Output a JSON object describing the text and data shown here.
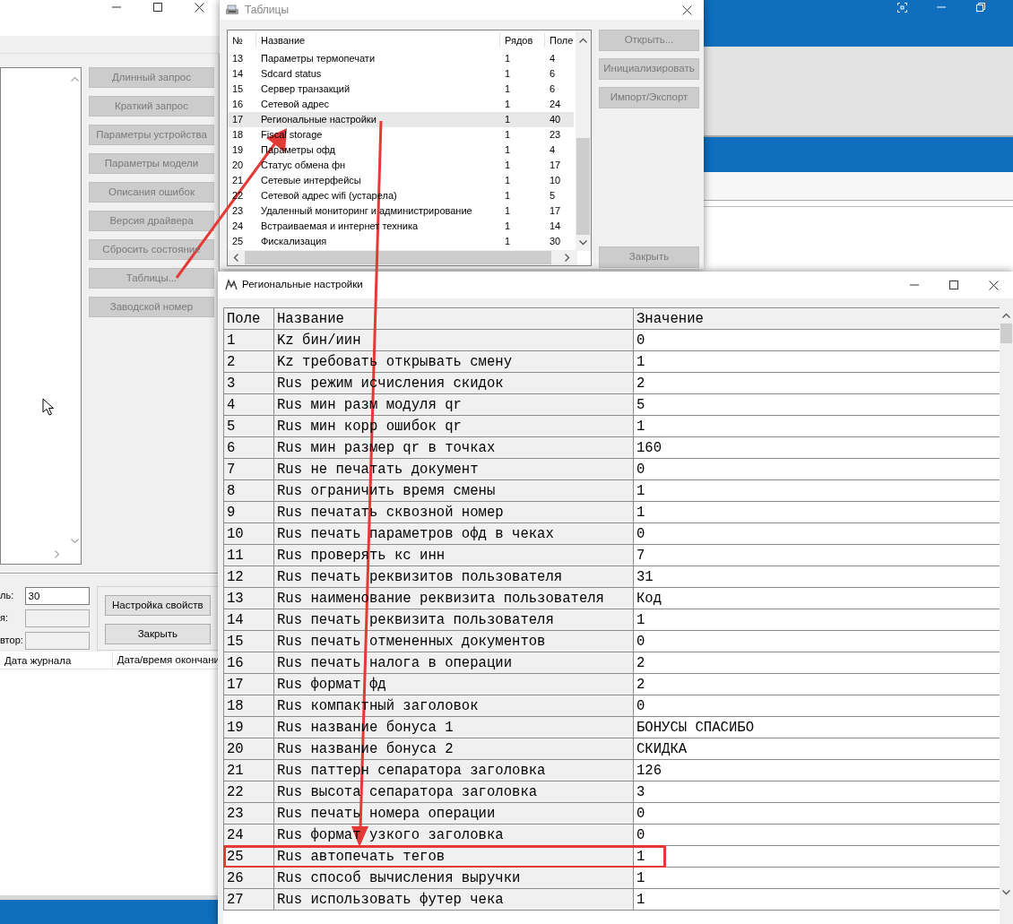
{
  "main_window": {
    "buttons": [
      {
        "label": "Длинный запрос",
        "disabled": true
      },
      {
        "label": "Краткий запрос",
        "disabled": true
      },
      {
        "label": "Параметры устройства",
        "disabled": true
      },
      {
        "label": "Параметры модели",
        "disabled": true
      },
      {
        "label": "Описания ошибок",
        "disabled": true
      },
      {
        "label": "Версия драйвера",
        "disabled": true
      },
      {
        "label": "Сбросить состояние",
        "disabled": true
      },
      {
        "label": "Таблицы...",
        "disabled": true
      },
      {
        "label": "Заводской номер",
        "disabled": true
      }
    ],
    "fields": [
      {
        "label": "ль:",
        "value": "30",
        "disabled": false
      },
      {
        "label": "я:",
        "disabled": true
      },
      {
        "label": "втор:",
        "disabled": true
      }
    ],
    "actions": [
      {
        "label": "Настройка свойств",
        "disabled": false
      },
      {
        "label": "Закрыть",
        "disabled": false
      }
    ],
    "journal_columns": [
      "Дата журнала",
      "Дата/время окончани"
    ]
  },
  "tables_window": {
    "title": "Таблицы",
    "columns": [
      "№",
      "Название",
      "Рядов",
      "Поле"
    ],
    "rows": [
      {
        "cells": [
          "13",
          "Параметры термопечати",
          "1",
          "4"
        ],
        "selected": false
      },
      {
        "cells": [
          "14",
          "Sdcard status",
          "1",
          "6"
        ],
        "selected": false
      },
      {
        "cells": [
          "15",
          "Сервер транзакций",
          "1",
          "6"
        ],
        "selected": false
      },
      {
        "cells": [
          "16",
          "Сетевой адрес",
          "1",
          "24"
        ],
        "selected": false
      },
      {
        "cells": [
          "17",
          "Региональные настройки",
          "1",
          "40"
        ],
        "selected": true
      },
      {
        "cells": [
          "18",
          "Fiscal storage",
          "1",
          "23"
        ],
        "selected": false
      },
      {
        "cells": [
          "19",
          "Параметры офд",
          "1",
          "4"
        ],
        "selected": false
      },
      {
        "cells": [
          "20",
          "Статус обмена фн",
          "1",
          "17"
        ],
        "selected": false
      },
      {
        "cells": [
          "21",
          "Сетевые интерфейсы",
          "1",
          "10"
        ],
        "selected": false
      },
      {
        "cells": [
          "22",
          "Сетевой адрес wifi (устарела)",
          "1",
          "5"
        ],
        "selected": false
      },
      {
        "cells": [
          "23",
          "Удаленный мониторинг и администрирование",
          "1",
          "17"
        ],
        "selected": false
      },
      {
        "cells": [
          "24",
          "Встраиваемая и интернет техника",
          "1",
          "14"
        ],
        "selected": false
      },
      {
        "cells": [
          "25",
          "Фискализация",
          "1",
          "30"
        ],
        "selected": false
      }
    ],
    "buttons": [
      {
        "label": "Открыть...",
        "disabled": true
      },
      {
        "label": "Инициализировать",
        "disabled": true
      },
      {
        "label": "Импорт/Экспорт",
        "disabled": true
      }
    ],
    "close_button": {
      "label": "Закрыть",
      "disabled": true
    }
  },
  "regional_window": {
    "title": "Региональные настройки",
    "columns": [
      "Поле",
      "Название",
      "Значение"
    ],
    "rows": [
      {
        "cells": [
          "1",
          "Kz бин/иин",
          "0"
        ],
        "highlighted": false
      },
      {
        "cells": [
          "2",
          "Kz требовать открывать смену",
          "1"
        ],
        "highlighted": false
      },
      {
        "cells": [
          "3",
          "Rus режим исчисления скидок",
          "2"
        ],
        "highlighted": false
      },
      {
        "cells": [
          "4",
          "Rus мин разм модуля qr",
          "5"
        ],
        "highlighted": false
      },
      {
        "cells": [
          "5",
          "Rus мин корр ошибок qr",
          "1"
        ],
        "highlighted": false
      },
      {
        "cells": [
          "6",
          "Rus мин размер qr в точках",
          "160"
        ],
        "highlighted": false
      },
      {
        "cells": [
          "7",
          "Rus не печатать документ",
          "0"
        ],
        "highlighted": false
      },
      {
        "cells": [
          "8",
          "Rus ограничить время смены",
          "1"
        ],
        "highlighted": false
      },
      {
        "cells": [
          "9",
          "Rus печатать сквозной номер",
          "1"
        ],
        "highlighted": false
      },
      {
        "cells": [
          "10",
          "Rus печать параметров офд в чеках",
          "0"
        ],
        "highlighted": false
      },
      {
        "cells": [
          "11",
          "Rus проверять кс инн",
          "7"
        ],
        "highlighted": false
      },
      {
        "cells": [
          "12",
          "Rus печать реквизитов пользователя",
          "31"
        ],
        "highlighted": false
      },
      {
        "cells": [
          "13",
          "Rus наименование реквизита пользователя",
          "Код"
        ],
        "highlighted": false
      },
      {
        "cells": [
          "14",
          "Rus печать реквизита пользователя",
          "1"
        ],
        "highlighted": false
      },
      {
        "cells": [
          "15",
          "Rus печать отмененных документов",
          "0"
        ],
        "highlighted": false
      },
      {
        "cells": [
          "16",
          "Rus печать налога в операции",
          "2"
        ],
        "highlighted": false
      },
      {
        "cells": [
          "17",
          "Rus формат фд",
          "2"
        ],
        "highlighted": false
      },
      {
        "cells": [
          "18",
          "Rus компактный заголовок",
          "0"
        ],
        "highlighted": false
      },
      {
        "cells": [
          "19",
          "Rus название бонуса 1",
          "БОНУСЫ СПАСИБО"
        ],
        "highlighted": false
      },
      {
        "cells": [
          "20",
          "Rus название бонуса 2",
          "СКИДКА"
        ],
        "highlighted": false
      },
      {
        "cells": [
          "21",
          "Rus паттерн сепаратора заголовка",
          "126"
        ],
        "highlighted": false
      },
      {
        "cells": [
          "22",
          "Rus высота сепаратора заголовка",
          "3"
        ],
        "highlighted": false
      },
      {
        "cells": [
          "23",
          "Rus печать номера операции",
          "0"
        ],
        "highlighted": false
      },
      {
        "cells": [
          "24",
          "Rus формат узкого заголовка",
          "0"
        ],
        "highlighted": false
      },
      {
        "cells": [
          "25",
          "Rus автопечать тегов",
          "1"
        ],
        "highlighted": true
      },
      {
        "cells": [
          "26",
          "Rus способ вычисления выручки",
          "1"
        ],
        "highlighted": false
      },
      {
        "cells": [
          "27",
          "Rus использовать футер чека",
          "1"
        ],
        "highlighted": false
      }
    ]
  }
}
